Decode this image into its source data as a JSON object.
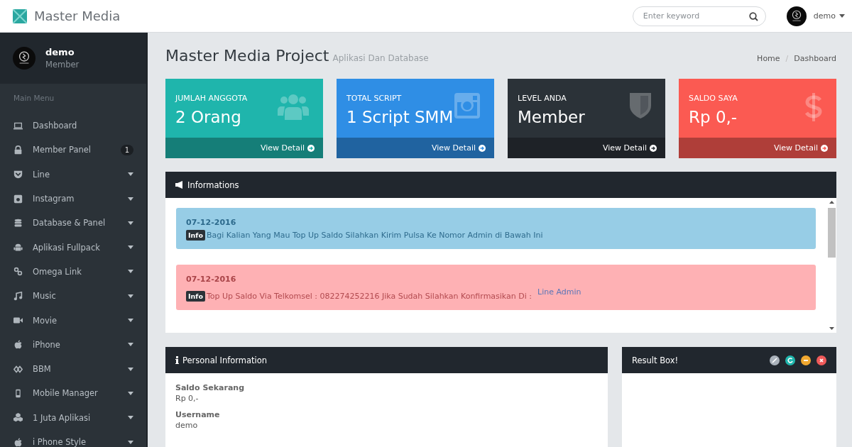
{
  "brand": {
    "title": "Master Media"
  },
  "topbar": {
    "search": {
      "placeholder": "Enter keyword"
    },
    "user": "demo"
  },
  "sidebar": {
    "user": {
      "name": "demo",
      "role": "Member"
    },
    "heading": "Main Menu",
    "items": [
      {
        "label": "Dashboard",
        "expandable": false
      },
      {
        "label": "Member Panel",
        "expandable": false,
        "badge": "1"
      },
      {
        "label": "Line",
        "expandable": true
      },
      {
        "label": "Instagram",
        "expandable": true
      },
      {
        "label": "Database & Panel",
        "expandable": true
      },
      {
        "label": "Aplikasi Fullpack",
        "expandable": true
      },
      {
        "label": "Omega Link",
        "expandable": true
      },
      {
        "label": "Music",
        "expandable": true
      },
      {
        "label": "Movie",
        "expandable": true
      },
      {
        "label": "iPhone",
        "expandable": true
      },
      {
        "label": "BBM",
        "expandable": true
      },
      {
        "label": "Mobile Manager",
        "expandable": true
      },
      {
        "label": "1 Juta Aplikasi",
        "expandable": true
      },
      {
        "label": "i Phone Style",
        "expandable": true
      }
    ]
  },
  "page": {
    "title": "Master Media Project",
    "subtitle": "Aplikasi Dan Database",
    "breadcrumb": [
      "Home",
      "Dashboard"
    ],
    "breadcrumb_separator": "/"
  },
  "stats": [
    {
      "label": "JUMLAH ANGGOTA",
      "value": "2 Orang",
      "link": "View Detail",
      "color": "#1fb5ac"
    },
    {
      "label": "TOTAL SCRIPT",
      "value": "1 Script SMM",
      "link": "View Detail",
      "color": "#2f8ee5"
    },
    {
      "label": "LEVEL ANDA",
      "value": "Member",
      "link": "View Detail",
      "color": "#2b3238"
    },
    {
      "label": "SALDO SAYA",
      "value": "Rp 0,-",
      "link": "View Detail",
      "color": "#fb5a52"
    }
  ],
  "informations": {
    "title": "Informations",
    "alerts": [
      {
        "kind": "info",
        "date": "07-12-2016",
        "tag": "Info",
        "text": "Bagi Kalian Yang Mau Top Up Saldo Silahkan Kirim Pulsa Ke Nomor Admin di Bawah Ini"
      },
      {
        "kind": "danger",
        "date": "07-12-2016",
        "tag": "Info",
        "text": "Top Up Saldo Via Telkomsel : 082274252216 Jika Sudah Silahkan Konfirmasikan Di :",
        "link": "Line Admin"
      }
    ]
  },
  "personal": {
    "title": "Personal Information",
    "fields": [
      {
        "label": "Saldo Sekarang",
        "value": "Rp 0,-"
      },
      {
        "label": "Username",
        "value": "demo"
      }
    ]
  },
  "result": {
    "title": "Result Box!"
  }
}
